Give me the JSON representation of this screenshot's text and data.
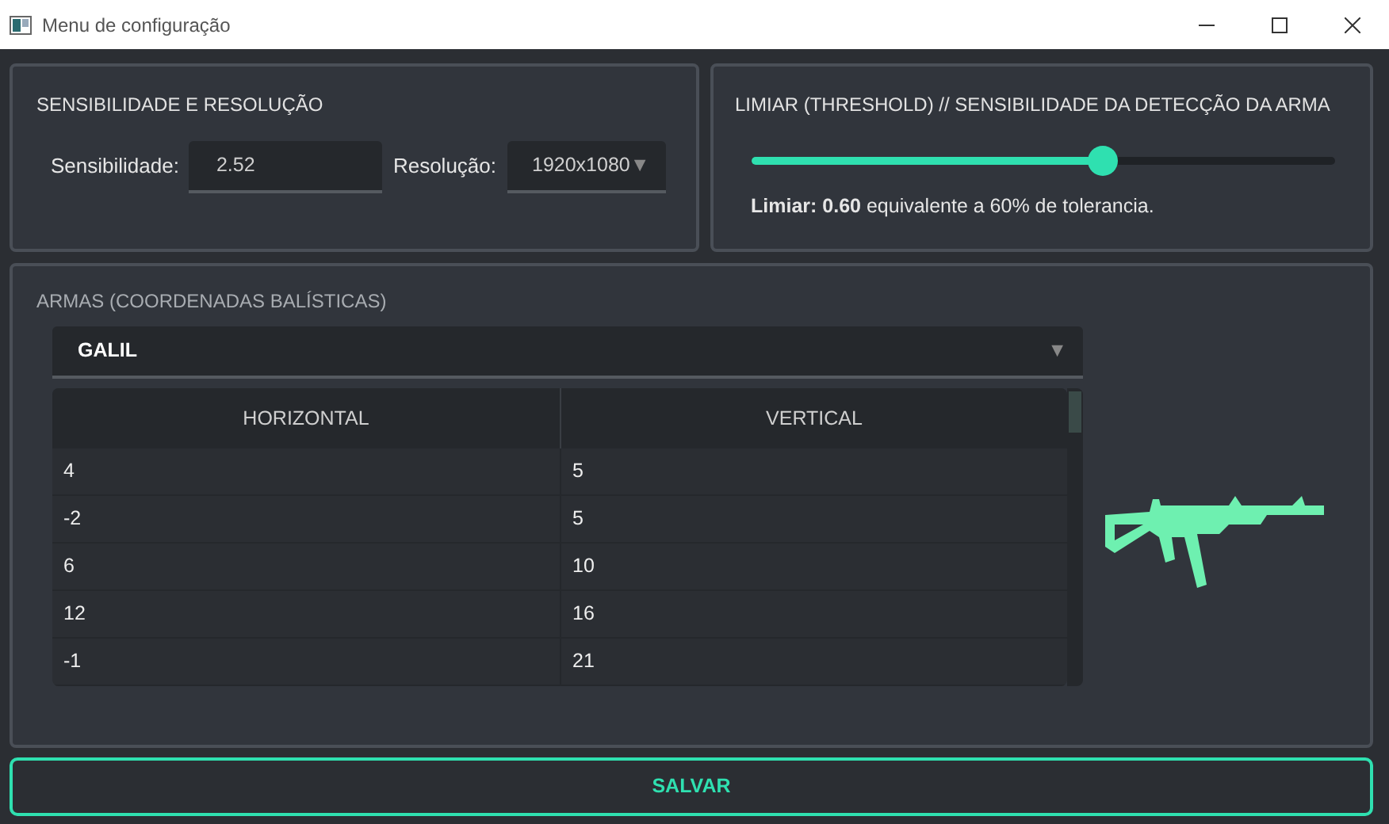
{
  "window": {
    "title": "Menu de configuração"
  },
  "sensitivity_panel": {
    "title": "SENSIBILIDADE E RESOLUÇÃO",
    "sensitivity_label": "Sensibilidade:",
    "sensitivity_value": "2.52",
    "resolution_label": "Resolução:",
    "resolution_value": "1920x1080",
    "resolution_arrow": "▼"
  },
  "threshold_panel": {
    "title": "LIMIAR (THRESHOLD) // SENSIBILIDADE DA DETECÇÃO DA ARMA",
    "level": 0.6,
    "description": "**Limiar: 0.60** equivalente a 60% de tolerancia."
  },
  "weapons_panel": {
    "title": "ARMAS (COORDENADAS BALÍSTICAS)",
    "weapon": "GALIL",
    "weapon_arrow": "▼",
    "table": {
      "columns": [
        "HORIZONTAL",
        "VERTICAL"
      ],
      "rows": [
        [
          "4",
          "5"
        ],
        [
          "-2",
          "5"
        ],
        [
          "6",
          "10"
        ],
        [
          "12",
          "16"
        ],
        [
          "-1",
          "21"
        ]
      ]
    }
  },
  "save_button": "SALVAR"
}
